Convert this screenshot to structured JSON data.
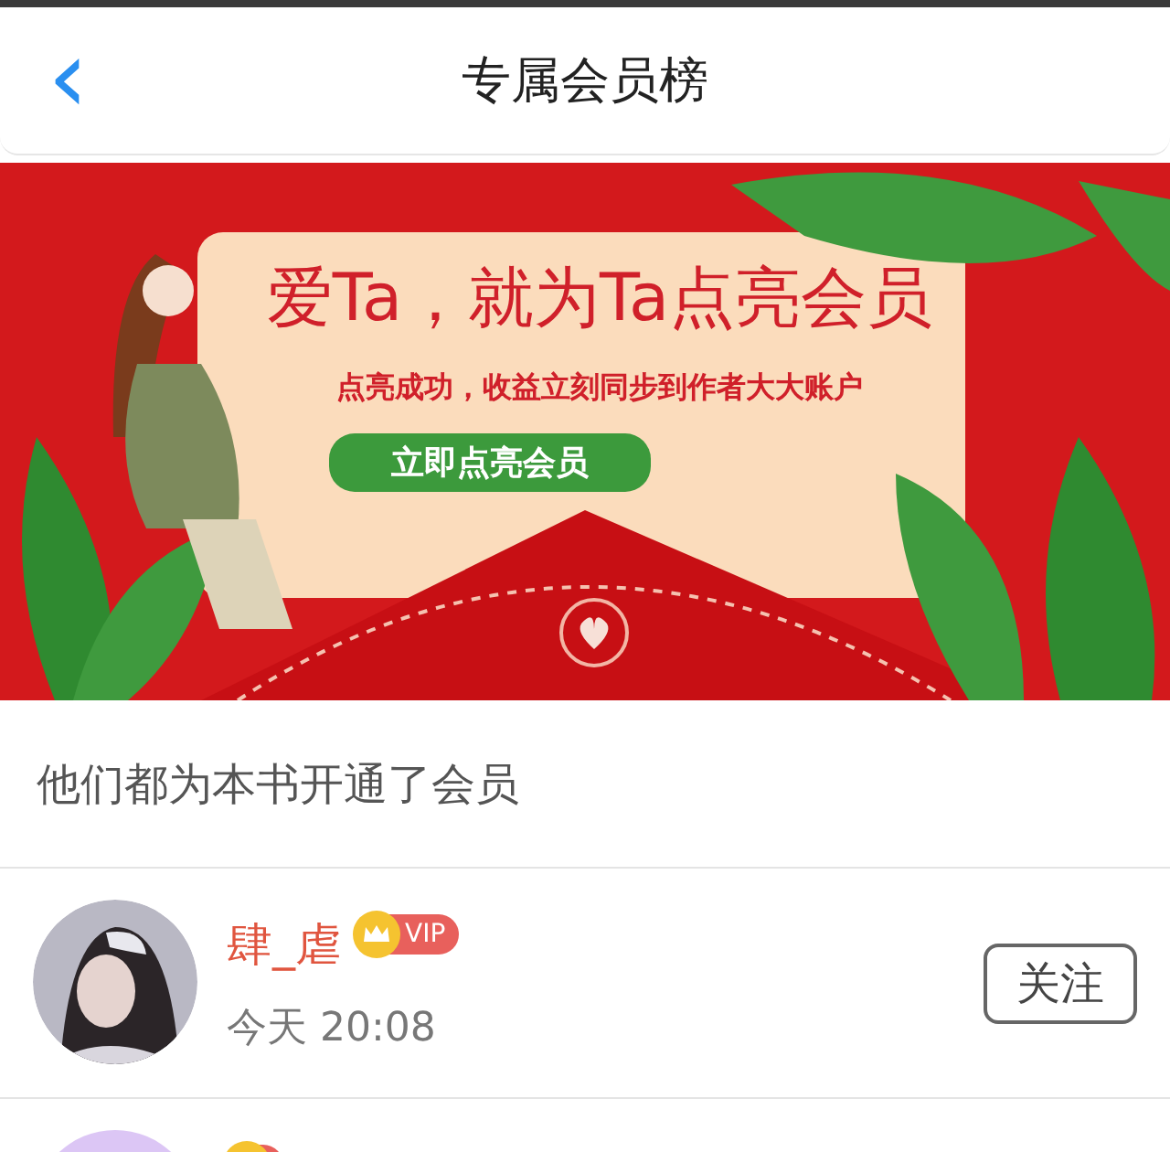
{
  "header": {
    "back_icon": "‹",
    "title": "专属会员榜"
  },
  "banner": {
    "headline": "爱Ta，就为Ta点亮会员",
    "subline": "点亮成功，收益立刻同步到作者大大账户",
    "button": "立即点亮会员"
  },
  "section_title": "他们都为本书开通了会员",
  "members": [
    {
      "name": "肆_虐",
      "vip": true,
      "badge": "VIP",
      "time": "今天 20:08",
      "follow": "关注"
    },
    {
      "avatar": {
        "kind": "plain",
        "color": "#dcc6f5"
      },
      "vip": true
    }
  ]
}
